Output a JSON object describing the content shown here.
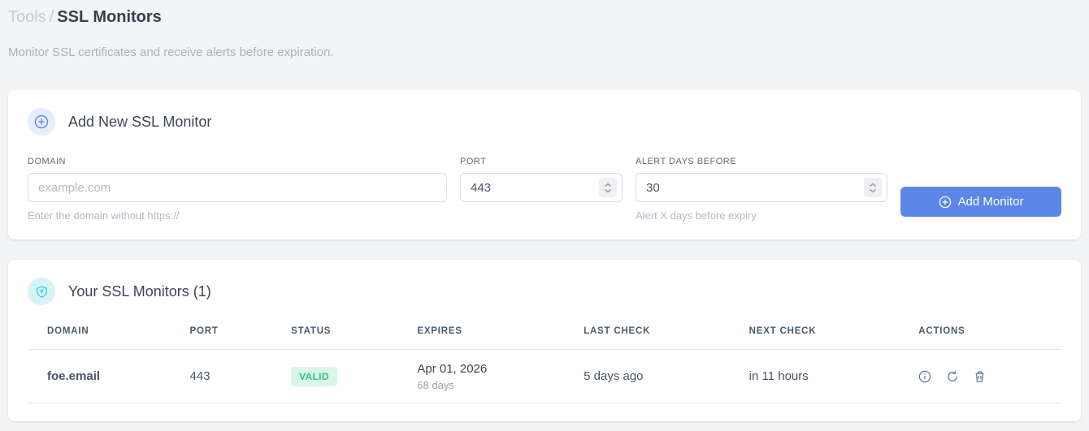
{
  "page": {
    "breadcrumb": {
      "section": "Tools",
      "separator": "/",
      "current": "SSL Monitors"
    },
    "subtitle": "Monitor SSL certificates and receive alerts before expiration."
  },
  "add_monitor": {
    "title": "Add New SSL Monitor",
    "fields": {
      "domain": {
        "label": "DOMAIN",
        "placeholder": "example.com",
        "value": "",
        "helper": "Enter the domain without https://"
      },
      "port": {
        "label": "PORT",
        "value": "443"
      },
      "alert_days": {
        "label": "ALERT DAYS BEFORE",
        "value": "30",
        "helper": "Alert X days before expiry"
      }
    },
    "submit_label": "Add Monitor"
  },
  "monitors": {
    "title": "Your SSL Monitors (1)",
    "table": {
      "headers": [
        "DOMAIN",
        "PORT",
        "STATUS",
        "EXPIRES",
        "LAST CHECK",
        "NEXT CHECK",
        "ACTIONS"
      ],
      "rows": [
        {
          "domain": "foe.email",
          "port": "443",
          "status": "VALID",
          "expires_date": "Apr 01, 2026",
          "expires_in": "68 days",
          "last_check": "5 days ago",
          "next_check": "in 11 hours"
        }
      ]
    }
  },
  "colors": {
    "accent_blue": "#5b87e8",
    "valid_badge_bg": "#d9f6e7",
    "valid_badge_text": "#31c48d",
    "shield_cyan": "#2bd0e0",
    "page_bg": "#f2f4f6"
  }
}
